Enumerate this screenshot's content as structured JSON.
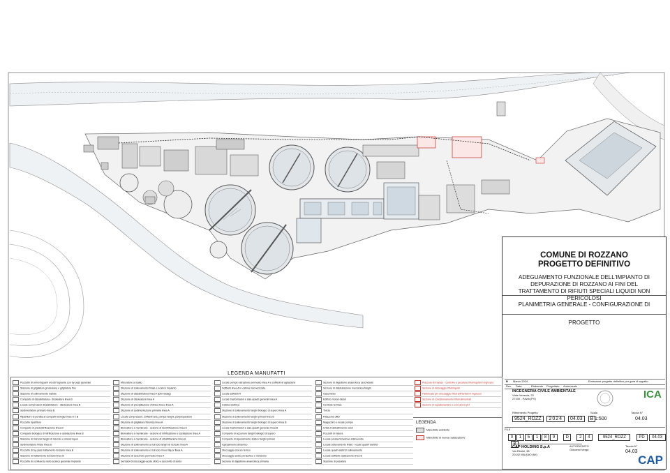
{
  "title_block": {
    "municipality": "COMUNE DI ROZZANO",
    "project_phase": "PROGETTO DEFINITIVO",
    "description": "ADEGUAMENTO FUNZIONALE DELL'IMPIANTO DI DEPURAZIONE DI ROZZANO AI FINI DEL TRATTAMENTO DI RIFIUTI SPECIALI LIQUIDI NON PERICOLOSI",
    "drawing_title": "PLANIMETRIA GENERALE - CONFIGURAZIONE DI PROGETTO",
    "revision_letter": "B",
    "revision_date": "Marzo 2024",
    "revision_note": "Emissione progetto definitivo per gara di appalto",
    "rev_headers": [
      "Rev.",
      "Data",
      "Elaborato",
      "Progettato",
      "Autorizzato"
    ],
    "designer_name": "INGEGNERIA CIVILE AMBIENTALE",
    "designer_address1": "Viale Venezia, 22",
    "designer_address2": "27100 - Pavia (PV)",
    "ref_project_label": "Riferimento Progetto",
    "ref_project": "9524_ROZZ",
    "year": "2024",
    "sheet_code": "04.03",
    "rev_small": "B",
    "scale_label": "Scala",
    "scale": "1:500",
    "tavola_label": "Tavola N°",
    "tavola": "04.03",
    "file_label": "FILE",
    "code_digits": [
      "0",
      "1",
      "5",
      "1",
      "8",
      "9"
    ],
    "lot_code": "D",
    "year_digits": [
      "2",
      "4"
    ],
    "file_name": "9524_ROZZ",
    "level": "PD",
    "file_tavola": "04.03",
    "file_rev": "B",
    "client_name": "CAP HOLDING S.p.A",
    "client_address1": "Via Rimini, 38",
    "client_address2": "20142 MILANO (MI)",
    "authorized_label": "AUTORIZZATO",
    "authorized_name": "Giovanni Vergà",
    "client_tavola_label": "Tavola N°",
    "client_tavola": "04.03",
    "cap_logo": "CAP",
    "ica_logo": "ICA"
  },
  "legend": {
    "title": "LEGENDA MANUFATTI",
    "col1": [
      "Pozzetto di arrivo liquami ed etti fognante con by pass generale",
      "Stazione di grigliatura grossolana e grigliatura fine",
      "Stazione di sollevamento iniziale",
      "Comparto di dissabbiatura - disoleatura linea B",
      "Locale compressori dissabbiatura - disoleatura linea B",
      "Sedimentatore primario linea B",
      "Ripartitore di portata ai comparti biologici linee A e B",
      "Pozzetto ripartitore",
      "Comparto di predenitrificazione linea B",
      "Comparto biologico di nitrificazione e ossidazione linea B",
      "Stazione di ricircolo fanghi di ricircolo e miscel liquor",
      "Sedimentatore finale linea B",
      "Pozzetto di by pass trattamento terziario linea B",
      "Stazione di trattamento terziario linea B",
      "Pozzetto di confluenza nello scarico generale impianto"
    ],
    "col2": [
      "Misuratore a risalto",
      "Stazione di sollevamento finale e scarico impianto",
      "Stazione di dissabbiatura linea A (Dennadag)",
      "Stazione di disoleatura linea A",
      "Stazione di precipitazione chimica fosco linea A",
      "Stazione di sedimentazione primaria linea A",
      "Locale compressori, soffianti aria, pompe fanghi, polipreparatore",
      "Stazione di grigliatura fisionica linea A",
      "Bioreattore a membrane - sezione di denitrificazione linea A",
      "Bioreattore a membrane - sezione di nitrificazione e ossidazione linea A",
      "Bioreattore a membrane - sezione di ultrafiltrazione linea A",
      "Stazione di sollevamento a ricircolo fanghi di ricircolo linea A",
      "Stazione di sollevamento e ricircolo mixed liquor linea A",
      "Stazione di accumulo permeato linea A",
      "Serbatoi di stoccaggio acido citrico e ipoclorito di sodio"
    ],
    "col3": [
      "Locale pompe estrazione permeato linea A e soffianti di agitazione",
      "Soffianti linea A in cabina insonorizzata",
      "Locale soffianti A",
      "Locale trasformatori e sala quadri generali linea A",
      "Cabina elettrica",
      "Stazione di sollevamento fanghi biologici di supero linea A",
      "Stazione di sollevamento fanghi primari linea B",
      "Stazione di sollevamento fanghi biologici di supero linea B",
      "Locale trasformatori e sala quadri generale linea B",
      "Comparto di accumulo fanghi biologici di supero",
      "Comparto di ispessimento statico fanghi primari",
      "Ispessimento dinamico",
      "Stoccaggio cloruro ferrico",
      "Stoccaggio acido peracetico e metanolo",
      "Sezione di digestione anaerobica primaria"
    ],
    "col4": [
      "Sezione di digestione anaerobica secondaria",
      "Sezione di disidratazione meccanica fanghi",
      "Gasometro",
      "Edificio motori diesel",
      "Centrale termica",
      "Torcia",
      "Palazzina uffici",
      "Magazzino e locale pompe",
      "Unità di abbattimento odori",
      "Pozzetti di misura",
      "Locale pressurizzazione antincendio",
      "Locale sollevamento finale - locale quadri elettrici",
      "Locale quadri elettrici sollevamento",
      "Locale soffianti ossidazione linea B",
      "Stazione di pesatura"
    ],
    "col5": [
      "Piazzola di travaso - controllo e pesatura rifiuti liquidi in ingresso",
      "Sezione di stoccaggio rifiuti liquidi",
      "Fabbricato per stoccaggio rifiuti alimentari in ingresso",
      "Sezione di condizionamento rifiuti alimentari",
      "Sezione di equalizzazione e correzione pH"
    ],
    "legenda_label": "LEGENDA",
    "legenda_items": [
      "Manufatto esistente",
      "Manufatto di nuova realizzazione"
    ]
  }
}
